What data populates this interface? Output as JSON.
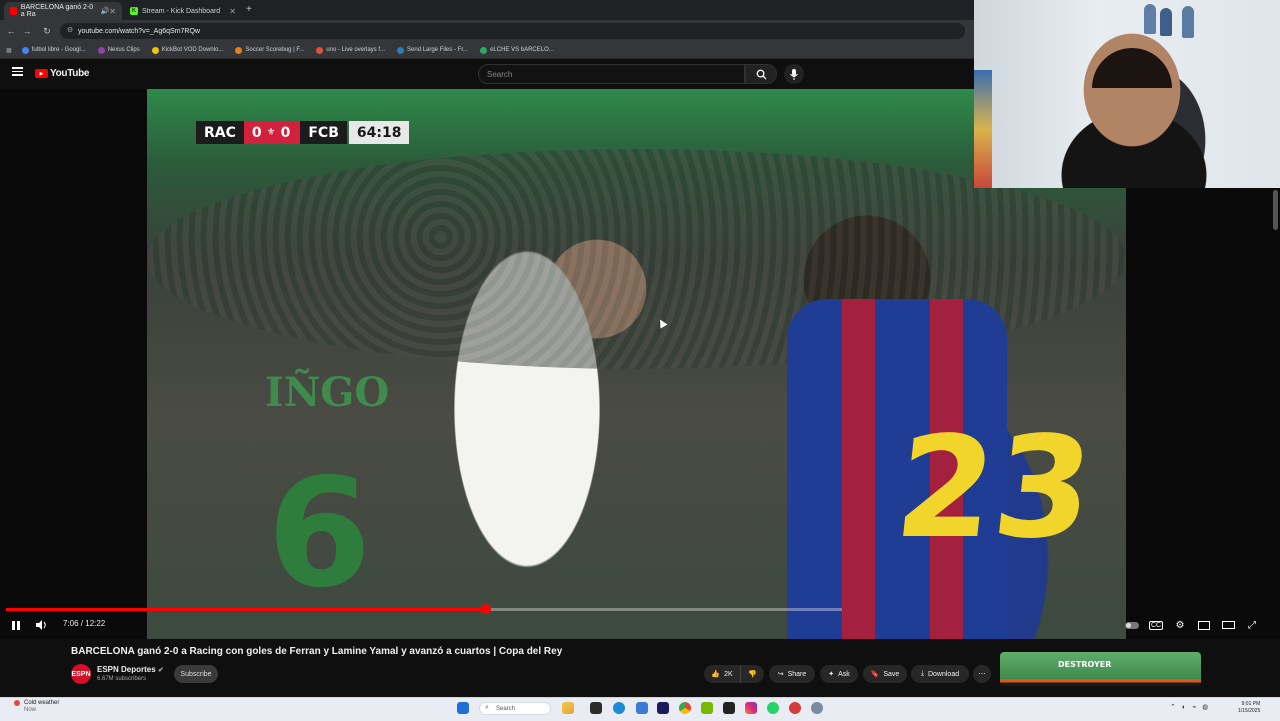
{
  "browser": {
    "tabs": [
      {
        "title": "BARCELONA ganó 2-0 a Ra",
        "favicon_color": "#ff0000",
        "active": true
      },
      {
        "title": "Stream - Kick Dashboard",
        "favicon_color": "#53fc18",
        "active": false
      }
    ],
    "url": "youtube.com/watch?v=_Ag6qSm7RQw",
    "bookmarks": [
      {
        "label": "futbol libre - Googl...",
        "color": "#4285f4"
      },
      {
        "label": "Nexus Clips",
        "color": "#8e44ad"
      },
      {
        "label": "KickBot VOD Downlo...",
        "color": "#f1c40f"
      },
      {
        "label": "Soccer Scorebug | F...",
        "color": "#e67e22"
      },
      {
        "label": "uno - Live overlays f...",
        "color": "#e74c3c"
      },
      {
        "label": "Send Large Files - Fr...",
        "color": "#2980b9"
      },
      {
        "label": "eLCHE VS bARCELO...",
        "color": "#27ae60"
      }
    ]
  },
  "youtube": {
    "logo_text": "YouTube",
    "search_placeholder": "Search"
  },
  "video": {
    "scorebug": {
      "home": "RAC",
      "home_score": "0",
      "away": "FCB",
      "away_score": "0",
      "clock": "64:18"
    },
    "player_left_name": "IÑGO",
    "player_left_number": "6",
    "player_right_number": "23",
    "time_current": "7:06",
    "time_total": "12:22",
    "time_display": "7:06 / 12:22",
    "progress_fraction": 0.574,
    "buffered_fraction": 0.999,
    "title": "BARCELONA ganó 2-0 a Racing con goles de Ferran y Lamine Yamal y avanzó a cuartos | Copa del Rey"
  },
  "channel": {
    "name": "ESPN Deportes",
    "subscribers": "6.67M subscribers",
    "avatar_text": "ESPN",
    "subscribe_label": "Subscribe"
  },
  "actions": {
    "likes": "2K",
    "share": "Share",
    "ask": "Ask",
    "save": "Save",
    "download": "Download"
  },
  "ad": {
    "text": "DESTROYER"
  },
  "taskbar": {
    "weather_temp": "Cold weather",
    "weather_sub": "Now",
    "search_placeholder": "Search",
    "time": "9:01 PM",
    "date": "1/15/2025"
  },
  "colors": {
    "accent": "#ff0000",
    "espn": "#d50f25"
  }
}
